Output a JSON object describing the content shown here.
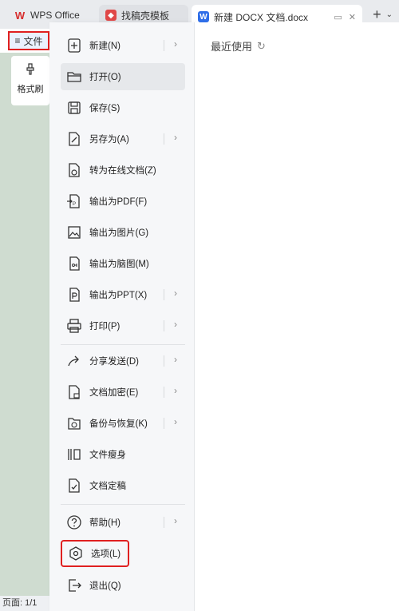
{
  "tabs": [
    {
      "label": "WPS Office",
      "icon": "wps-logo-icon"
    },
    {
      "label": "找稿壳模板",
      "icon": "template-icon"
    },
    {
      "label": "新建 DOCX 文档.docx",
      "icon": "word-doc-icon"
    }
  ],
  "file_button": {
    "icon": "≡",
    "label": "文件"
  },
  "format_painter": {
    "label": "格式刷"
  },
  "status": {
    "page": "页面: 1/1"
  },
  "recent": {
    "title": "最近使用"
  },
  "menu": {
    "items": [
      {
        "id": "new",
        "label": "新建(N)",
        "icon": "new-file-icon",
        "submenu": true
      },
      {
        "id": "open",
        "label": "打开(O)",
        "icon": "folder-open-icon",
        "submenu": false
      },
      {
        "id": "save",
        "label": "保存(S)",
        "icon": "save-icon",
        "submenu": false
      },
      {
        "id": "saveas",
        "label": "另存为(A)",
        "icon": "save-as-icon",
        "submenu": true
      },
      {
        "id": "online",
        "label": "转为在线文档(Z)",
        "icon": "cloud-doc-icon",
        "submenu": false
      },
      {
        "id": "pdf",
        "label": "输出为PDF(F)",
        "icon": "export-pdf-icon",
        "submenu": false
      },
      {
        "id": "img",
        "label": "输出为图片(G)",
        "icon": "export-image-icon",
        "submenu": false
      },
      {
        "id": "mind",
        "label": "输出为脑图(M)",
        "icon": "export-mindmap-icon",
        "submenu": false
      },
      {
        "id": "ppt",
        "label": "输出为PPT(X)",
        "icon": "export-ppt-icon",
        "submenu": true
      },
      {
        "id": "print",
        "label": "打印(P)",
        "icon": "printer-icon",
        "submenu": true
      },
      {
        "id": "share",
        "label": "分享发送(D)",
        "icon": "share-icon",
        "submenu": true
      },
      {
        "id": "encrypt",
        "label": "文档加密(E)",
        "icon": "lock-doc-icon",
        "submenu": true
      },
      {
        "id": "backup",
        "label": "备份与恢复(K)",
        "icon": "backup-icon",
        "submenu": true
      },
      {
        "id": "slim",
        "label": "文件瘦身",
        "icon": "compress-icon",
        "submenu": false
      },
      {
        "id": "final",
        "label": "文档定稿",
        "icon": "finalize-icon",
        "submenu": false
      },
      {
        "id": "help",
        "label": "帮助(H)",
        "icon": "help-icon",
        "submenu": true
      },
      {
        "id": "options",
        "label": "选项(L)",
        "icon": "gear-icon",
        "submenu": false
      },
      {
        "id": "exit",
        "label": "退出(Q)",
        "icon": "exit-icon",
        "submenu": false
      }
    ]
  },
  "colors": {
    "highlight": "#e02020",
    "accent": "#2f6ee8"
  }
}
